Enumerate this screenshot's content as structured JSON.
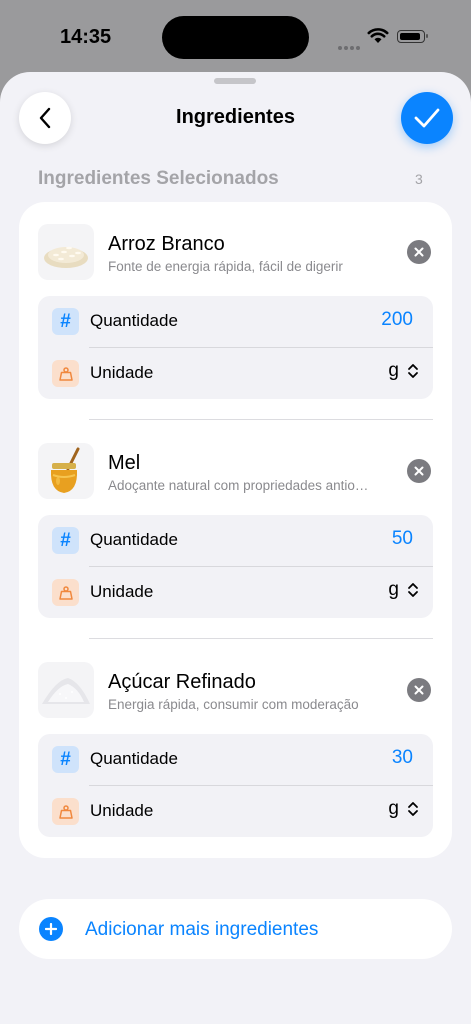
{
  "status_bar": {
    "time": "14:35"
  },
  "nav": {
    "title": "Ingredientes"
  },
  "section": {
    "header": "Ingredientes Selecionados",
    "count": "3"
  },
  "ingredients": [
    {
      "name": "Arroz Branco",
      "description": "Fonte de energia rápida, fácil de digerir",
      "quantity_label": "Quantidade",
      "quantity": "200",
      "unit_label": "Unidade",
      "unit": "g",
      "image_icon": "rice-icon"
    },
    {
      "name": "Mel",
      "description": "Adoçante natural com propriedades antioxidantes",
      "quantity_label": "Quantidade",
      "quantity": "50",
      "unit_label": "Unidade",
      "unit": "g",
      "image_icon": "honey-jar-icon"
    },
    {
      "name": "Açúcar Refinado",
      "description": "Energia rápida, consumir com moderação",
      "quantity_label": "Quantidade",
      "quantity": "30",
      "unit_label": "Unidade",
      "unit": "g",
      "image_icon": "sugar-icon"
    }
  ],
  "add_button": {
    "label": "Adicionar mais ingredientes"
  },
  "colors": {
    "accent": "#0a84ff",
    "background": "#f2f2f7",
    "card": "#ffffff",
    "secondary_text": "#8a8a8e"
  }
}
